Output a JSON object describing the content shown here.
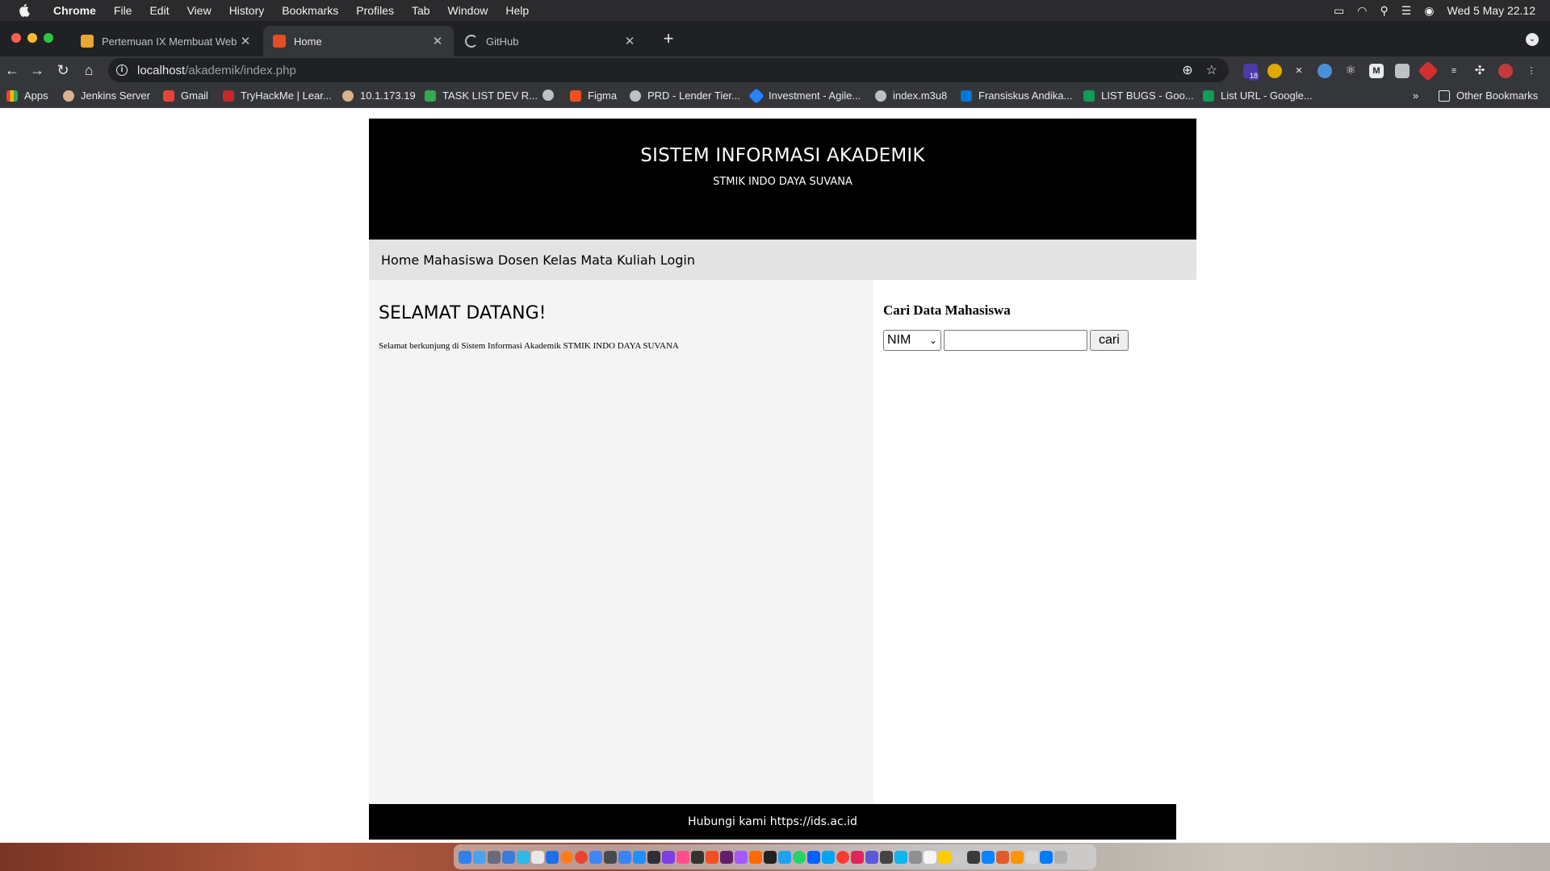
{
  "menubar": {
    "app": "Chrome",
    "items": [
      "File",
      "Edit",
      "View",
      "History",
      "Bookmarks",
      "Profiles",
      "Tab",
      "Window",
      "Help"
    ],
    "clock": "Wed 5 May  22.12"
  },
  "tabs": [
    {
      "title": "Pertemuan IX Membuat Web D",
      "favicon_color": "#e8a634"
    },
    {
      "title": "Home",
      "favicon_color": "#e44d26"
    },
    {
      "title": "GitHub",
      "favicon_color": "#bdc1c6"
    }
  ],
  "omnibox": {
    "host": "localhost",
    "path": "/akademik/index.php"
  },
  "extensions": {
    "badge_count": "18"
  },
  "bookmarks": [
    {
      "label": "Apps",
      "color": "#ea4335"
    },
    {
      "label": "Jenkins Server",
      "color": "#d9b38c"
    },
    {
      "label": "Gmail",
      "color": "#ea4335"
    },
    {
      "label": "TryHackMe | Lear...",
      "color": "#c62828"
    },
    {
      "label": "10.1.173.19",
      "color": "#d9b38c"
    },
    {
      "label": "TASK LIST DEV R...",
      "color": "#34a853"
    },
    {
      "label": "",
      "color": "#bdc1c6"
    },
    {
      "label": "Figma",
      "color": "#f24e1e"
    },
    {
      "label": "PRD - Lender Tier...",
      "color": "#bdc1c6"
    },
    {
      "label": "Investment - Agile...",
      "color": "#2684ff"
    },
    {
      "label": "index.m3u8",
      "color": "#bdc1c6"
    },
    {
      "label": "Fransiskus Andika...",
      "color": "#0078d4"
    },
    {
      "label": "LIST BUGS - Goo...",
      "color": "#0f9d58"
    },
    {
      "label": "List URL - Google...",
      "color": "#0f9d58"
    }
  ],
  "other_bookmarks": "Other Bookmarks",
  "site": {
    "title": "SISTEM INFORMASI AKADEMIK",
    "subtitle": "STMIK INDO DAYA SUVANA",
    "nav": [
      "Home",
      "Mahasiswa",
      "Dosen",
      "Kelas",
      "Mata Kuliah",
      "Login"
    ],
    "welcome_title": "SELAMAT DATANG!",
    "welcome_text": "Selamat berkunjung di Sistem Informasi Akademik STMIK INDO DAYA SUVANA",
    "search_title": "Cari Data Mahasiswa",
    "search_select_value": "NIM",
    "search_input_value": "",
    "search_button": "cari",
    "footer": "Hubungi kami https://ids.ac.id"
  }
}
